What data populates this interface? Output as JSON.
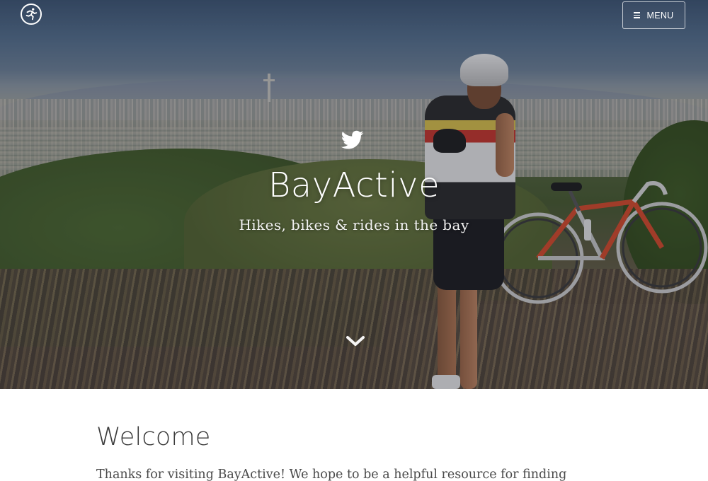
{
  "nav": {
    "logo_icon": "running-person-icon",
    "menu_icon": "hamburger-icon",
    "menu_label": "MENU"
  },
  "hero": {
    "icon": "twitter-bird-icon",
    "title": "BayActive",
    "subtitle": "Hikes, bikes & rides in the bay",
    "scroll_icon": "chevron-down-icon"
  },
  "welcome": {
    "heading": "Welcome",
    "text": "Thanks for visiting BayActive! We hope to be a helpful resource for finding"
  },
  "colors": {
    "hero_text": "#ffffff",
    "heading_text": "#3b3b3b",
    "body_text": "#4a4a4a",
    "page_background": "#ffffff"
  }
}
